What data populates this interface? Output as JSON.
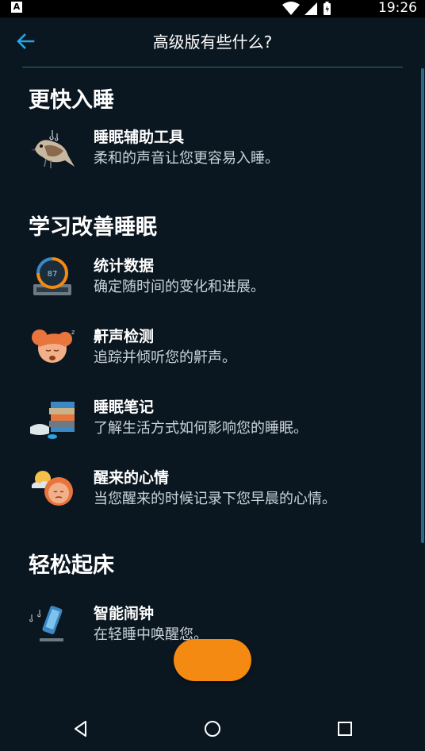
{
  "status_bar": {
    "left_badge": "A",
    "time": "19:26",
    "icons": [
      "wifi-icon",
      "cell-signal-icon",
      "battery-charging-icon"
    ]
  },
  "app_bar": {
    "title": "高级版有些什么?",
    "back_icon": "arrow-left-icon",
    "accent_color": "#2aa3e0"
  },
  "sections": [
    {
      "title": "更快入睡",
      "items": [
        {
          "icon": "sparrow-singing-icon",
          "title": "睡眠辅助工具",
          "subtitle": "柔和的声音让您更容易入睡。"
        }
      ]
    },
    {
      "title": "学习改善睡眠",
      "items": [
        {
          "icon": "statistics-gauge-icon",
          "title": "统计数据",
          "subtitle": "确定随时间的变化和进展。"
        },
        {
          "icon": "snoring-face-icon",
          "title": "鼾声检测",
          "subtitle": "追踪并倾听您的鼾声。"
        },
        {
          "icon": "books-notes-icon",
          "title": "睡眠笔记",
          "subtitle": "了解生活方式如何影响您的睡眠。"
        },
        {
          "icon": "wake-mood-face-icon",
          "title": "醒来的心情",
          "subtitle": "当您醒来的时候记录下您早晨的心情。"
        }
      ]
    },
    {
      "title": "轻松起床",
      "items": [
        {
          "icon": "smart-alarm-phone-icon",
          "title": "智能闹钟",
          "subtitle": "在轻睡中唤醒您。"
        }
      ]
    }
  ],
  "gauge_value": "87",
  "cta_button": {
    "label": "",
    "color": "#f58a12"
  },
  "nav_bar": {
    "icons": [
      "back-triangle-icon",
      "home-circle-icon",
      "recents-square-icon"
    ]
  }
}
